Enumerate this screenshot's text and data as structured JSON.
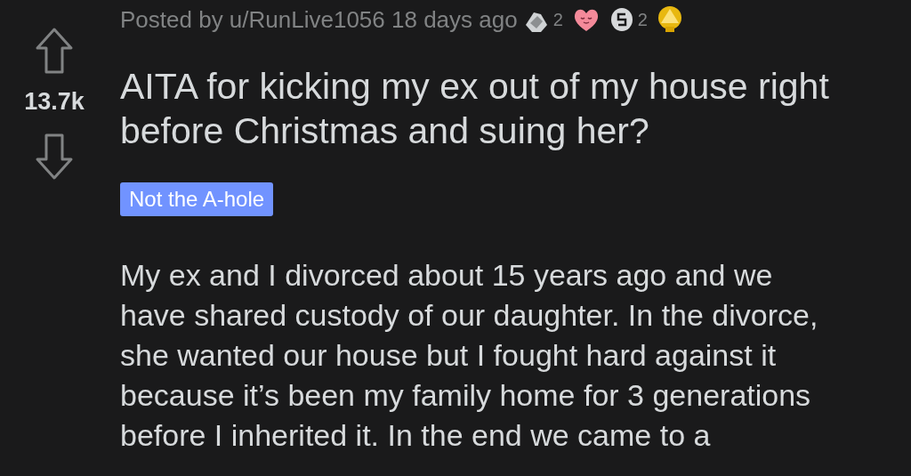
{
  "post": {
    "byline": "Posted by u/RunLive1056 18 days ago",
    "awards": [
      {
        "kind": "hands",
        "count": "2"
      },
      {
        "kind": "heart"
      },
      {
        "kind": "coin",
        "count": "2"
      },
      {
        "kind": "gold"
      }
    ],
    "score": "13.7k",
    "title": "AITA for kicking my ex out of my house right before Christmas and suing her?",
    "flair": "Not the A-hole",
    "body_lines": [
      "My ex and I divorced about 15 years ago and we",
      "have shared custody of our daughter. In the divorce,",
      "she wanted our house but I fought hard against it",
      "because it’s been my family home for 3 generations",
      "before I inherited it. In the end we came to a"
    ]
  }
}
